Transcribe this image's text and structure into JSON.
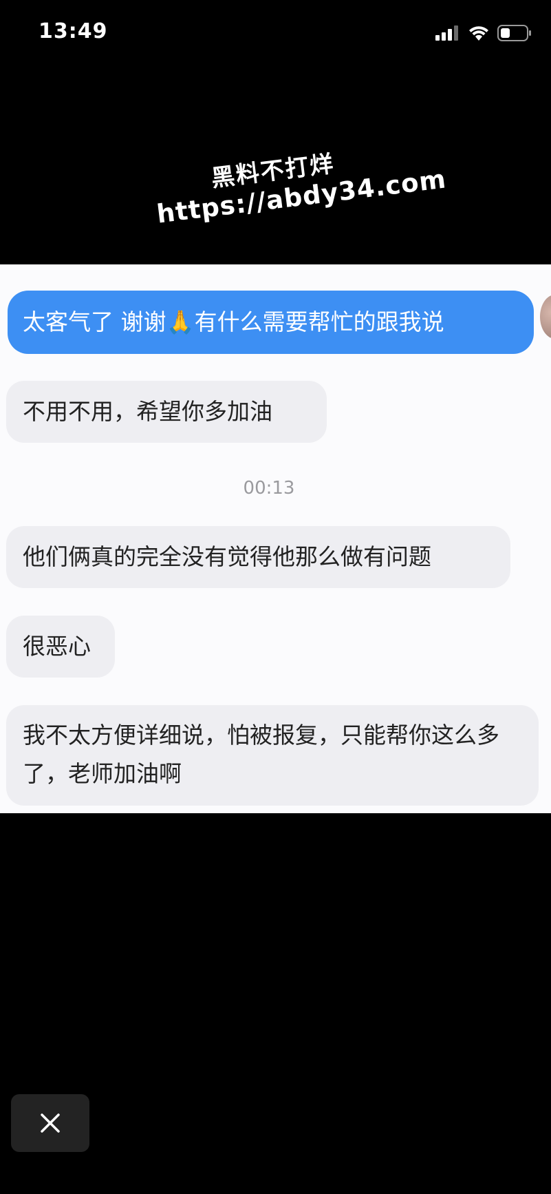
{
  "status_bar": {
    "time": "13:49",
    "icons": [
      "signal-icon",
      "wifi-icon",
      "battery-icon"
    ]
  },
  "watermark": {
    "line1": "黑料不打烊",
    "line2": "https://abdy34.com"
  },
  "chat": {
    "outgoing_message": "太客气了 谢谢🙏有什么需要帮忙的跟我说",
    "incoming_1": "不用不用，希望你多加油",
    "timestamp": "00:13",
    "incoming_2": "他们俩真的完全没有觉得他那么做有问题",
    "incoming_3": "很恶心",
    "incoming_4": "我不太方便详细说，怕被报复，只能帮你这么多了，老师加油啊"
  },
  "controls": {
    "close_icon": "close-icon"
  },
  "colors": {
    "outgoing_bubble": "#3d8ff3",
    "incoming_bubble": "#eeeef2",
    "background": "#000000",
    "chat_background": "#fbfbfd"
  }
}
